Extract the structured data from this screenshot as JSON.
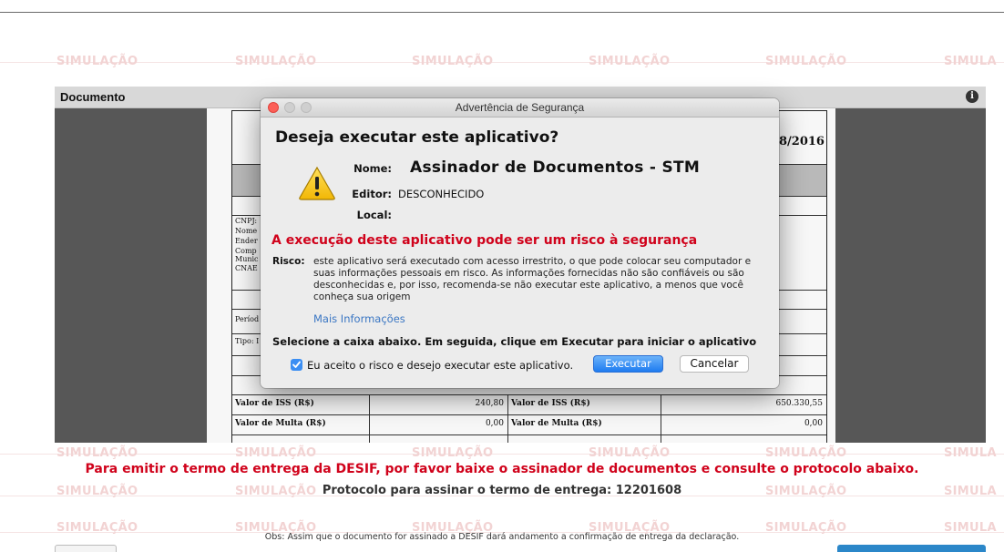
{
  "watermark": {
    "text": "SIMULAÇÃO",
    "text_cut": "SIMULA"
  },
  "document_panel": {
    "title": "Documento"
  },
  "document_page": {
    "date_fragment": "8/2016",
    "side_labels": [
      "CNPJ:",
      "Nome",
      "Ender",
      "Comp",
      "Munic",
      "CNAE"
    ],
    "periodo": "Períod",
    "tipo": "Tipo: I",
    "rows": [
      {
        "left_label": "Valor de ISS (R$)",
        "left_value": "240,80",
        "right_label": "Valor de ISS (R$)",
        "right_value": "650.330,55"
      },
      {
        "left_label": "Valor de Multa (R$)",
        "left_value": "0,00",
        "right_label": "Valor de Multa (R$)",
        "right_value": "0,00"
      }
    ]
  },
  "dialog": {
    "window_title": "Advertência de Segurança",
    "question": "Deseja executar este aplicativo?",
    "name_label": "Nome:",
    "name_value": "Assinador de Documentos - STM",
    "publisher_label": "Editor:",
    "publisher_value": "DESCONHECIDO",
    "location_label": "Local:",
    "location_value": "",
    "risk_title": "A execução deste aplicativo pode ser um risco à segurança",
    "risk_label": "Risco:",
    "risk_text": "este aplicativo será executado com acesso irrestrito, o que pode colocar seu computador e suas informações pessoais em risco. As informações fornecidas não são confiáveis ou são desconhecidas e, por isso, recomenda-se não executar este aplicativo, a menos que você conheça sua origem",
    "more_info": "Mais Informações",
    "select_instruction": "Selecione a caixa abaixo. Em seguida, clique em Executar para iniciar o aplicativo",
    "accept_checkbox_label": "Eu aceito o risco e desejo executar este aplicativo.",
    "accept_checked": true,
    "execute_button": "Executar",
    "cancel_button": "Cancelar"
  },
  "page_message": "Para emitir o termo de entrega da DESIF, por favor baixe o assinador de documentos e consulte o protocolo abaixo.",
  "protocol_line": "Protocolo para assinar o termo de entrega: 12201608",
  "obs_line": "Obs: Assim que o documento for assinado a DESIF dará andamento a confirmação de entrega da declaração.",
  "colors": {
    "alert_red": "#d0021b",
    "watermark_pink": "#f2d3d3",
    "dark_panel": "#575757",
    "primary_blue": "#2b87c9",
    "mac_close": "#fc5f57",
    "mac_inactive": "#cfcfcf"
  }
}
